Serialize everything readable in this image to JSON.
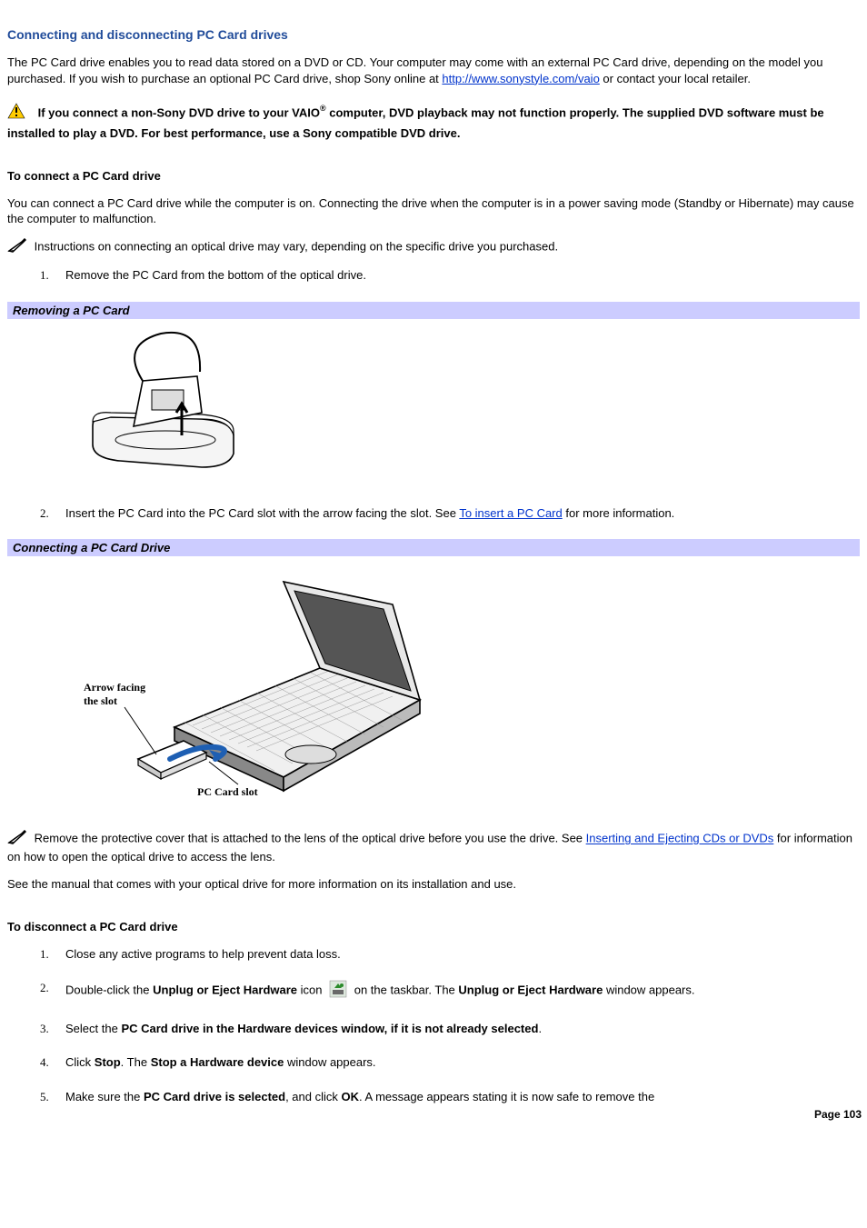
{
  "title": "Connecting and disconnecting PC Card drives",
  "intro": {
    "part1": "The PC Card drive enables you to read data stored on a DVD or CD. Your computer may come with an external PC Card drive, depending on the model you purchased. If you wish to purchase an optional PC Card drive, shop Sony online at ",
    "link_text": "http://www.sonystyle.com/vaio",
    "part2": " or contact your local retailer."
  },
  "warning": {
    "part1": "If you connect a non-Sony DVD drive to your VAIO",
    "reg": "®",
    "part2": " computer, DVD playback may not function properly. The supplied DVD software must be installed to play a DVD. For best performance, use a Sony compatible DVD drive."
  },
  "connect": {
    "heading": "To connect a PC Card drive",
    "para": "You can connect a PC Card drive while the computer is on. Connecting the drive when the computer is in a power saving mode (Standby or Hibernate) may cause the computer to malfunction.",
    "note": "Instructions on connecting an optical drive may vary, depending on the specific drive you purchased.",
    "step1": "Remove the PC Card from the bottom of the optical drive.",
    "caption1": "Removing a PC Card",
    "step2": {
      "a": "Insert the PC Card into the PC Card slot with the arrow facing the slot. See ",
      "link": "To insert a PC Card",
      "b": " for more information."
    },
    "caption2": "Connecting a PC Card Drive",
    "fig2_labels": {
      "arrow_top": "Arrow facing",
      "arrow_bot": "the slot",
      "slot": "PC Card slot"
    }
  },
  "after_fig_note": {
    "a": "Remove the protective cover that is attached to the lens of the optical drive before you use the drive. See ",
    "link": "Inserting and Ejecting CDs or DVDs",
    "b": " for information on how to open the optical drive to access the lens."
  },
  "manual_line": "See the manual that comes with your optical drive for more information on its installation and use.",
  "disconnect": {
    "heading": "To disconnect a PC Card drive",
    "step1": "Close any active programs to help prevent data loss.",
    "step2": {
      "a": "Double-click the ",
      "b": "Unplug or Eject Hardware",
      "c": " icon ",
      "d": " on the taskbar. The ",
      "e": "Unplug or Eject Hardware",
      "f": " window appears."
    },
    "step3": {
      "a": "Select the ",
      "b": "PC Card drive in the Hardware devices window, if it is not already selected",
      "c": "."
    },
    "step4": {
      "a": "Click ",
      "b": "Stop",
      "c": ". The ",
      "d": "Stop a Hardware device",
      "e": " window appears."
    },
    "step5": {
      "a": "Make sure the ",
      "b": "PC Card drive is selected",
      "c": ", and click ",
      "d": "OK",
      "e": ". A message appears stating it is now safe to remove the"
    }
  },
  "page_number": "Page 103"
}
